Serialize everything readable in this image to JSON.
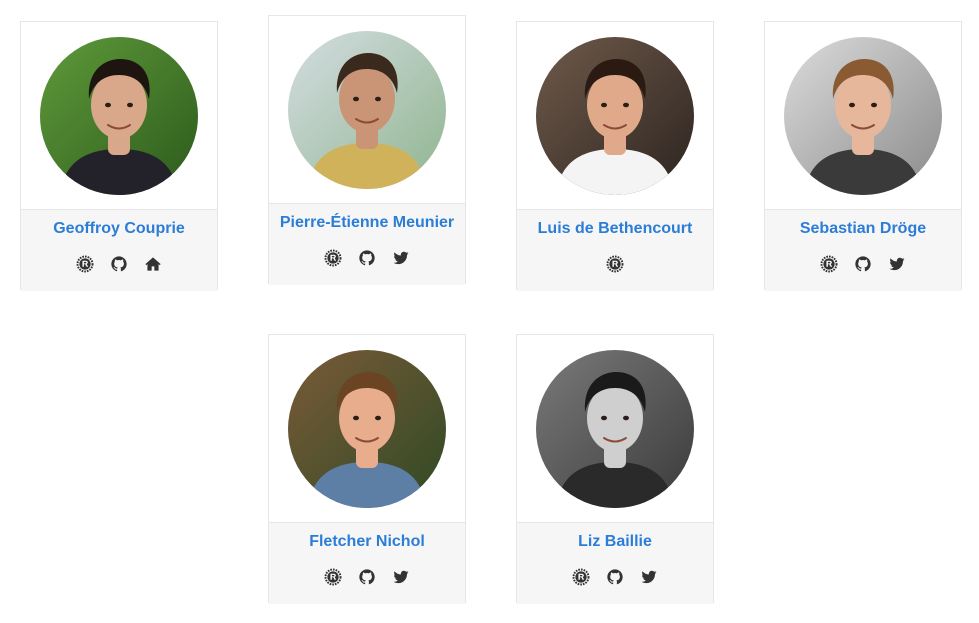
{
  "people": [
    {
      "name": "Geoffroy Couprie",
      "links": [
        "rust-icon",
        "github-icon",
        "home-icon"
      ],
      "photo": {
        "bg1": "#5f9a3a",
        "bg2": "#2c5a1c",
        "skin": "#d9a88a",
        "hair": "#1e1410",
        "shirt": "#23222a"
      }
    },
    {
      "name": "Pierre-Étienne Meunier",
      "links": [
        "rust-icon",
        "github-icon",
        "twitter-icon"
      ],
      "photo": {
        "bg1": "#d5dde2",
        "bg2": "#8fb58f",
        "skin": "#c99576",
        "hair": "#3a2a1e",
        "shirt": "#cfb25a"
      }
    },
    {
      "name": "Luis de Bethencourt",
      "links": [
        "rust-icon"
      ],
      "photo": {
        "bg1": "#6f5a4a",
        "bg2": "#2c2420",
        "skin": "#e0aa8a",
        "hair": "#2a1a12",
        "shirt": "#f4f4f4"
      }
    },
    {
      "name": "Sebastian Dröge",
      "links": [
        "rust-icon",
        "github-icon",
        "twitter-icon"
      ],
      "photo": {
        "bg1": "#dcdcdc",
        "bg2": "#8a8a8a",
        "skin": "#e6b79b",
        "hair": "#8a5a32",
        "shirt": "#3a3a3a"
      }
    },
    {
      "name": "Fletcher Nichol",
      "links": [
        "rust-icon",
        "github-icon",
        "twitter-icon"
      ],
      "photo": {
        "bg1": "#7a5a38",
        "bg2": "#2f4a24",
        "skin": "#e7ad8c",
        "hair": "#6b4424",
        "shirt": "#5d7fa6"
      }
    },
    {
      "name": "Liz Baillie",
      "links": [
        "rust-icon",
        "github-icon",
        "twitter-icon"
      ],
      "photo": {
        "bg1": "#7a7a7a",
        "bg2": "#3a3a3a",
        "skin": "#cfcfcf",
        "hair": "#1a1a1a",
        "shirt": "#2a2a2a"
      }
    }
  ]
}
